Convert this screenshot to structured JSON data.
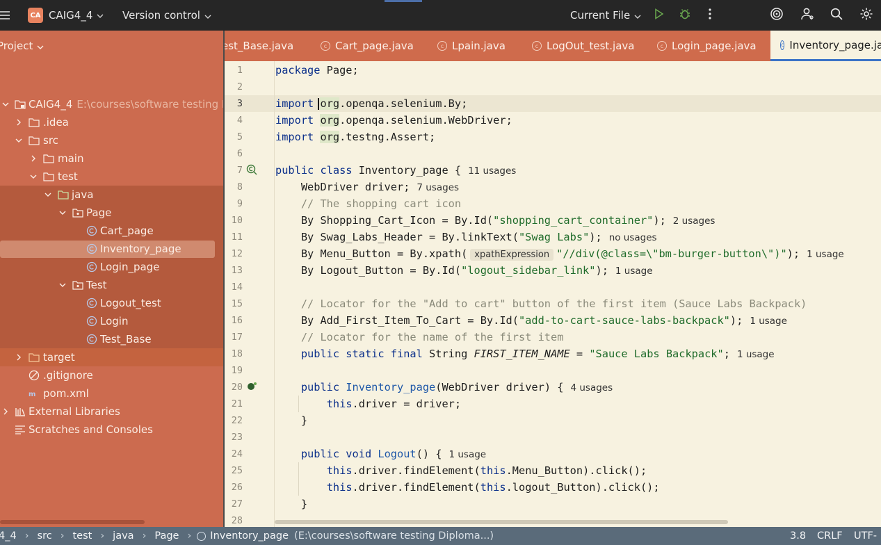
{
  "titlebar": {
    "project_badge": "CA",
    "project_name": "CAIG4_4",
    "version_control": "Version control",
    "run_config": "Current File"
  },
  "project_panel": {
    "title": "Project",
    "tree": [
      {
        "label": "CAIG4_4",
        "path": "E:\\courses\\software testing Dipl"
      },
      {
        "label": ".idea"
      },
      {
        "label": "src"
      },
      {
        "label": "main"
      },
      {
        "label": "test"
      },
      {
        "label": "java"
      },
      {
        "label": "Page"
      },
      {
        "label": "Cart_page"
      },
      {
        "label": "Inventory_page"
      },
      {
        "label": "Login_page"
      },
      {
        "label": "Test"
      },
      {
        "label": "Logout_test"
      },
      {
        "label": "Login"
      },
      {
        "label": "Test_Base"
      },
      {
        "label": "target"
      },
      {
        "label": ".gitignore"
      },
      {
        "label": "pom.xml"
      },
      {
        "label": "External Libraries"
      },
      {
        "label": "Scratches and Consoles"
      }
    ]
  },
  "tabs": [
    {
      "label": "est_Base.java"
    },
    {
      "label": "Cart_page.java"
    },
    {
      "label": "Lpain.java"
    },
    {
      "label": "LogOut_test.java"
    },
    {
      "label": "Login_page.java"
    },
    {
      "label": "Inventory_page.jav"
    }
  ],
  "editor": {
    "line_numbers": [
      "1",
      "2",
      "3",
      "4",
      "5",
      "6",
      "7",
      "8",
      "9",
      "10",
      "11",
      "12",
      "13",
      "14",
      "15",
      "16",
      "17",
      "18",
      "19",
      "20",
      "21",
      "22",
      "23",
      "24",
      "25",
      "26",
      "27",
      "28"
    ],
    "hints": {
      "l7": "11 usages",
      "l8": "7 usages",
      "l10": "2 usages",
      "l11": "no usages",
      "l12_inlay": "xpathExpression",
      "l12": "1 usage",
      "l13": "1 usage",
      "l16": "1 usage",
      "l18": "1 usage",
      "l20": "4 usages",
      "l24": "1 usage"
    }
  },
  "statusbar": {
    "crumbs": [
      "4_4",
      "src",
      "test",
      "java",
      "Page",
      "Inventory_page"
    ],
    "file_path": "(E:\\courses\\software testing Diploma...)",
    "position": "3.8",
    "line_sep": "CRLF",
    "encoding": "UTF-"
  },
  "colors": {
    "panel": "#cc6b4f",
    "panel_dark": "#b45a3d",
    "editor_bg": "#f7f2e0",
    "titlebar": "#262626",
    "statusbar": "#5a6b7a",
    "tab_active_underline": "#3b73c7"
  }
}
